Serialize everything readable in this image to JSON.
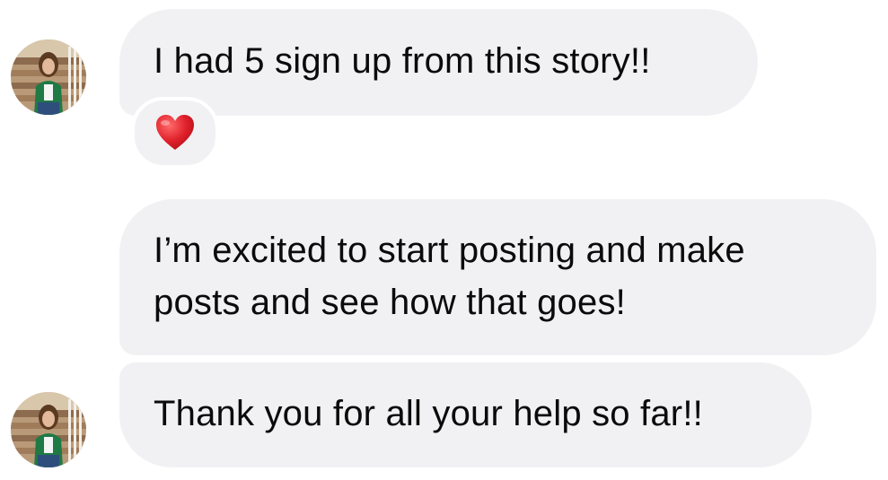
{
  "messages": [
    {
      "text": "I had 5 sign up from this story!!",
      "reaction": "heart-icon"
    },
    {
      "line1": "I’m excited to start posting and make",
      "line2": "posts and see how that goes!"
    },
    {
      "text": "Thank you for all your help so far!!"
    }
  ],
  "colors": {
    "bubble": "#f1f1f3",
    "text": "#0b0b0b",
    "heart": "#e0202b"
  }
}
